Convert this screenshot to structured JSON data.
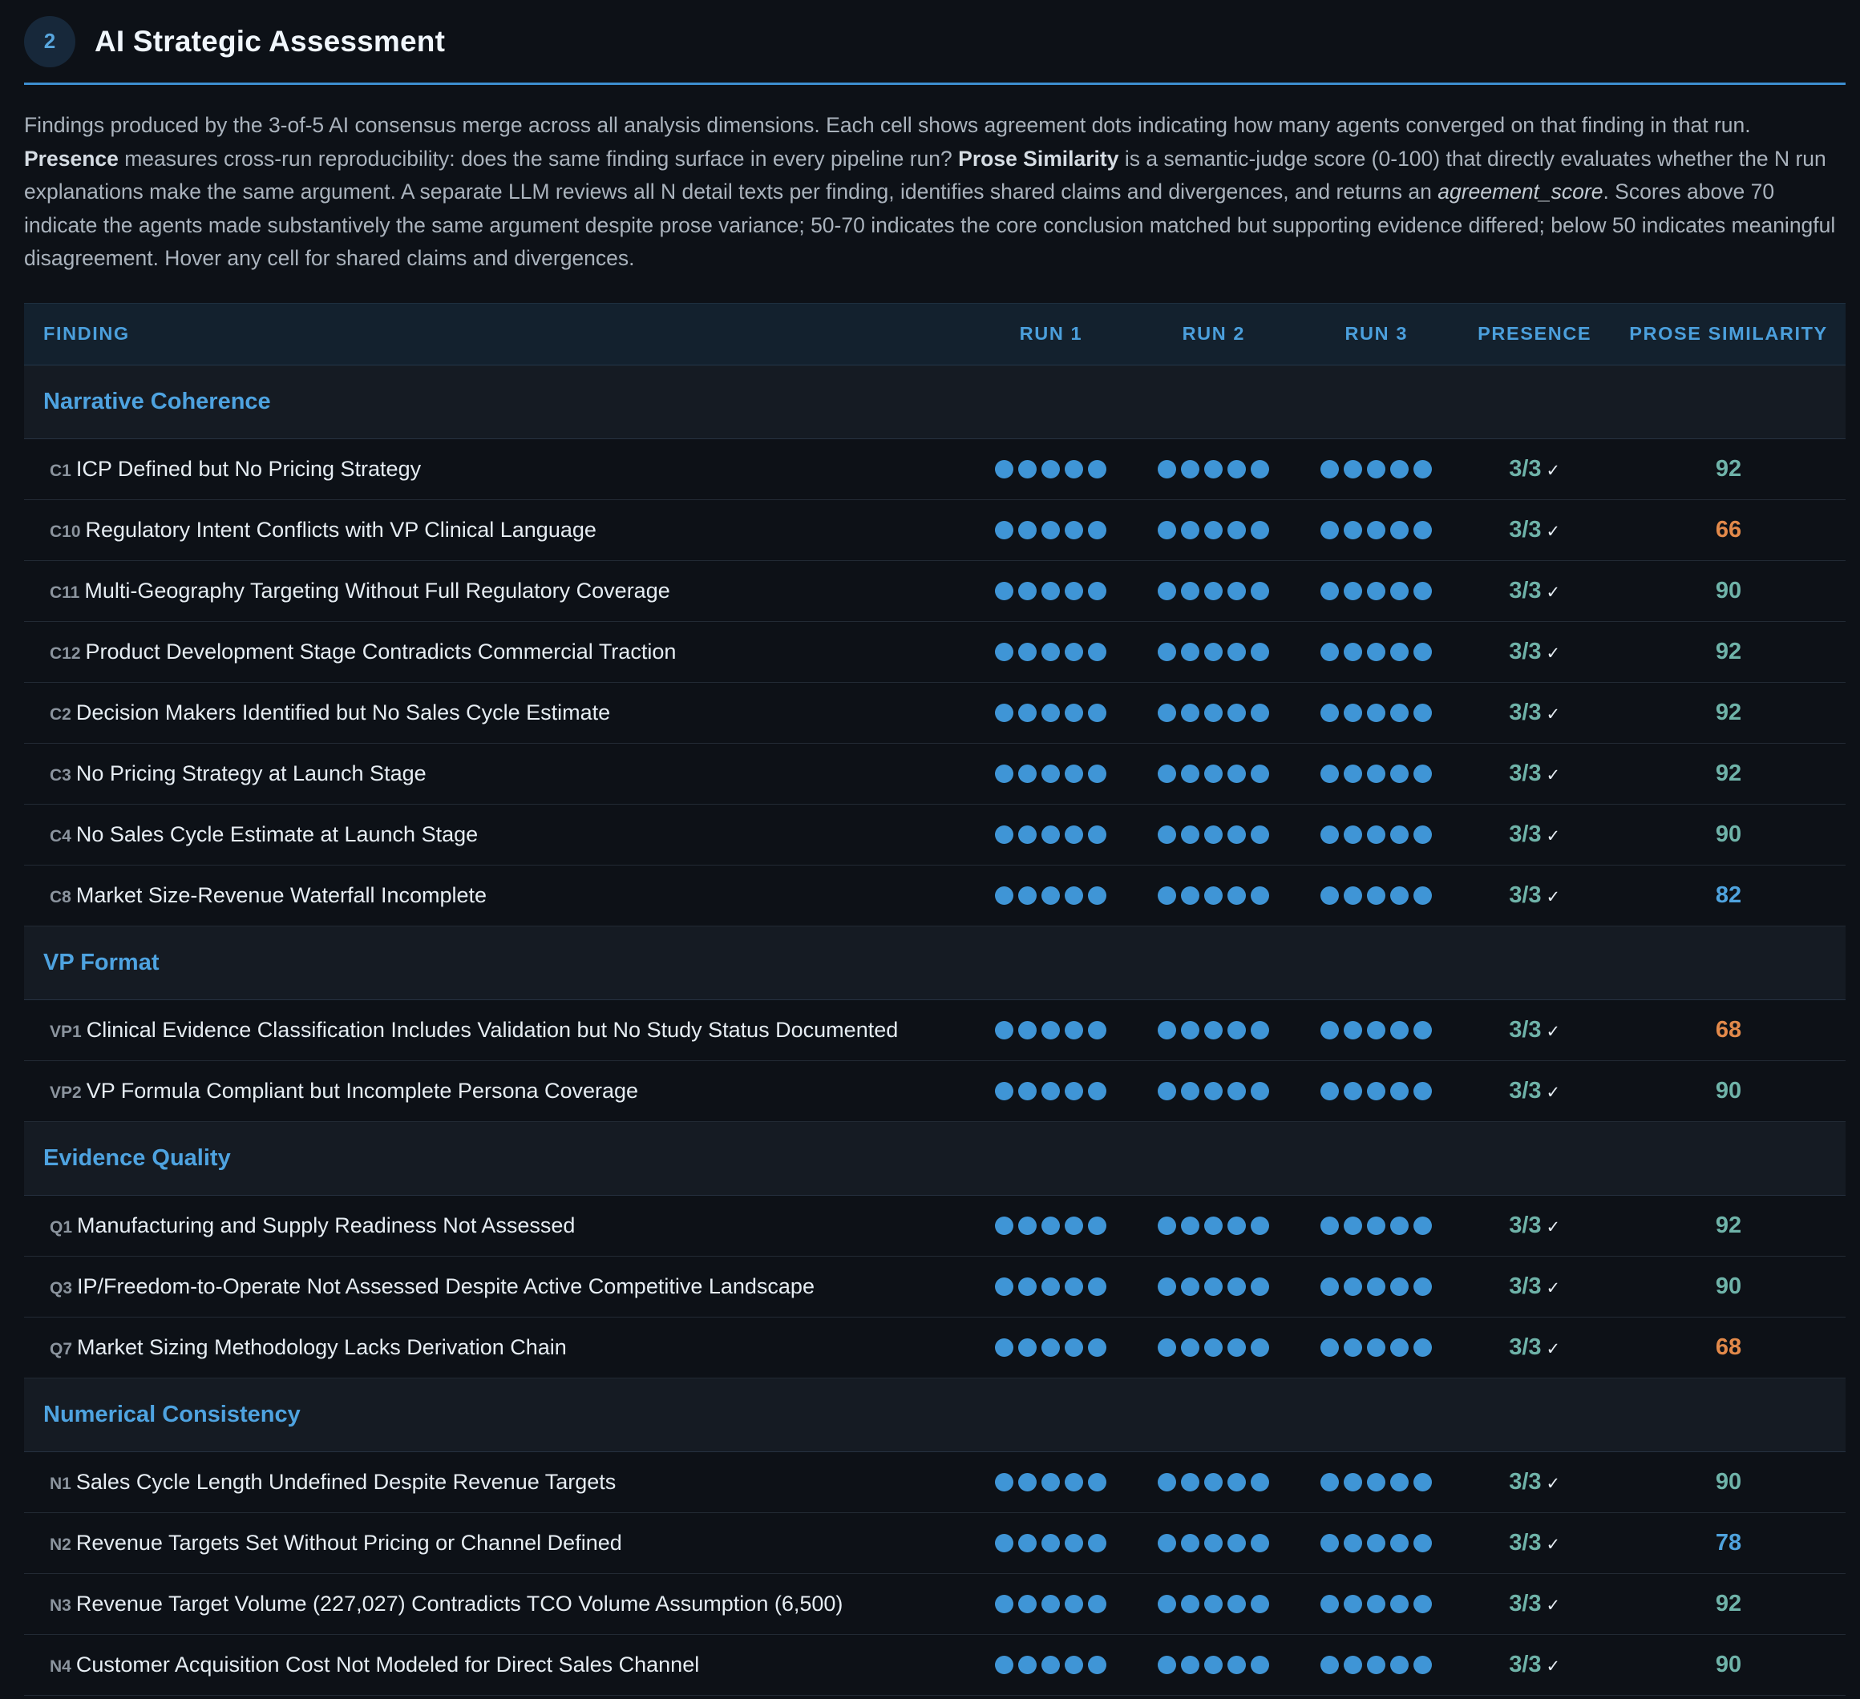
{
  "section": {
    "number": "2",
    "title": "AI Strategic Assessment"
  },
  "description": {
    "p1": "Findings produced by the 3-of-5 AI consensus merge across all analysis dimensions. Each cell shows agreement dots indicating how many agents converged on that finding in that run. ",
    "presence_term": "Presence",
    "p2": " measures cross-run reproducibility: does the same finding surface in every pipeline run? ",
    "similarity_term": "Prose Similarity",
    "p3": " is a semantic-judge score (0-100) that directly evaluates whether the N run explanations make the same argument. A separate LLM reviews all N detail texts per finding, identifies shared claims and divergences, and returns an ",
    "score_term": "agreement_score",
    "p4": ". Scores above 70 indicate the agents made substantively the same argument despite prose variance; 50-70 indicates the core conclusion matched but supporting evidence differed; below 50 indicates meaningful disagreement. Hover any cell for shared claims and divergences."
  },
  "table": {
    "headers": {
      "finding": "Finding",
      "run1": "Run 1",
      "run2": "Run 2",
      "run3": "Run 3",
      "presence": "Presence",
      "similarity": "Prose Similarity"
    },
    "check_glyph": "✓",
    "accent_colors": {
      "high": "#6fb3a9",
      "mid": "#e2894a",
      "blue": "#4fa3de",
      "dot": "#3f95d6"
    },
    "groups": [
      {
        "label": "Narrative Coherence",
        "rows": [
          {
            "id": "C1",
            "title": "ICP Defined but No Pricing Strategy",
            "runs": [
              5,
              5,
              5
            ],
            "presence": "3/3",
            "similarity": "92",
            "tone": "high"
          },
          {
            "id": "C10",
            "title": "Regulatory Intent Conflicts with VP Clinical Language",
            "runs": [
              5,
              5,
              5
            ],
            "presence": "3/3",
            "similarity": "66",
            "tone": "mid"
          },
          {
            "id": "C11",
            "title": "Multi-Geography Targeting Without Full Regulatory Coverage",
            "runs": [
              5,
              5,
              5
            ],
            "presence": "3/3",
            "similarity": "90",
            "tone": "high"
          },
          {
            "id": "C12",
            "title": "Product Development Stage Contradicts Commercial Traction",
            "runs": [
              5,
              5,
              5
            ],
            "presence": "3/3",
            "similarity": "92",
            "tone": "high"
          },
          {
            "id": "C2",
            "title": "Decision Makers Identified but No Sales Cycle Estimate",
            "runs": [
              5,
              5,
              5
            ],
            "presence": "3/3",
            "similarity": "92",
            "tone": "high"
          },
          {
            "id": "C3",
            "title": "No Pricing Strategy at Launch Stage",
            "runs": [
              5,
              5,
              5
            ],
            "presence": "3/3",
            "similarity": "92",
            "tone": "high"
          },
          {
            "id": "C4",
            "title": "No Sales Cycle Estimate at Launch Stage",
            "runs": [
              5,
              5,
              5
            ],
            "presence": "3/3",
            "similarity": "90",
            "tone": "high"
          },
          {
            "id": "C8",
            "title": "Market Size-Revenue Waterfall Incomplete",
            "runs": [
              5,
              5,
              5
            ],
            "presence": "3/3",
            "similarity": "82",
            "tone": "blue"
          }
        ]
      },
      {
        "label": "VP Format",
        "rows": [
          {
            "id": "VP1",
            "title": "Clinical Evidence Classification Includes Validation but No Study Status Documented",
            "runs": [
              5,
              5,
              5
            ],
            "presence": "3/3",
            "similarity": "68",
            "tone": "mid"
          },
          {
            "id": "VP2",
            "title": "VP Formula Compliant but Incomplete Persona Coverage",
            "runs": [
              5,
              5,
              5
            ],
            "presence": "3/3",
            "similarity": "90",
            "tone": "high"
          }
        ]
      },
      {
        "label": "Evidence Quality",
        "rows": [
          {
            "id": "Q1",
            "title": "Manufacturing and Supply Readiness Not Assessed",
            "runs": [
              5,
              5,
              5
            ],
            "presence": "3/3",
            "similarity": "92",
            "tone": "high"
          },
          {
            "id": "Q3",
            "title": "IP/Freedom-to-Operate Not Assessed Despite Active Competitive Landscape",
            "runs": [
              5,
              5,
              5
            ],
            "presence": "3/3",
            "similarity": "90",
            "tone": "high"
          },
          {
            "id": "Q7",
            "title": "Market Sizing Methodology Lacks Derivation Chain",
            "runs": [
              5,
              5,
              5
            ],
            "presence": "3/3",
            "similarity": "68",
            "tone": "mid"
          }
        ]
      },
      {
        "label": "Numerical Consistency",
        "rows": [
          {
            "id": "N1",
            "title": "Sales Cycle Length Undefined Despite Revenue Targets",
            "runs": [
              5,
              5,
              5
            ],
            "presence": "3/3",
            "similarity": "90",
            "tone": "high"
          },
          {
            "id": "N2",
            "title": "Revenue Targets Set Without Pricing or Channel Defined",
            "runs": [
              5,
              5,
              5
            ],
            "presence": "3/3",
            "similarity": "78",
            "tone": "blue"
          },
          {
            "id": "N3",
            "title": "Revenue Target Volume (227,027) Contradicts TCO Volume Assumption (6,500)",
            "runs": [
              5,
              5,
              5
            ],
            "presence": "3/3",
            "similarity": "92",
            "tone": "high"
          },
          {
            "id": "N4",
            "title": "Customer Acquisition Cost Not Modeled for Direct Sales Channel",
            "runs": [
              5,
              5,
              5
            ],
            "presence": "3/3",
            "similarity": "90",
            "tone": "high"
          }
        ]
      }
    ]
  }
}
